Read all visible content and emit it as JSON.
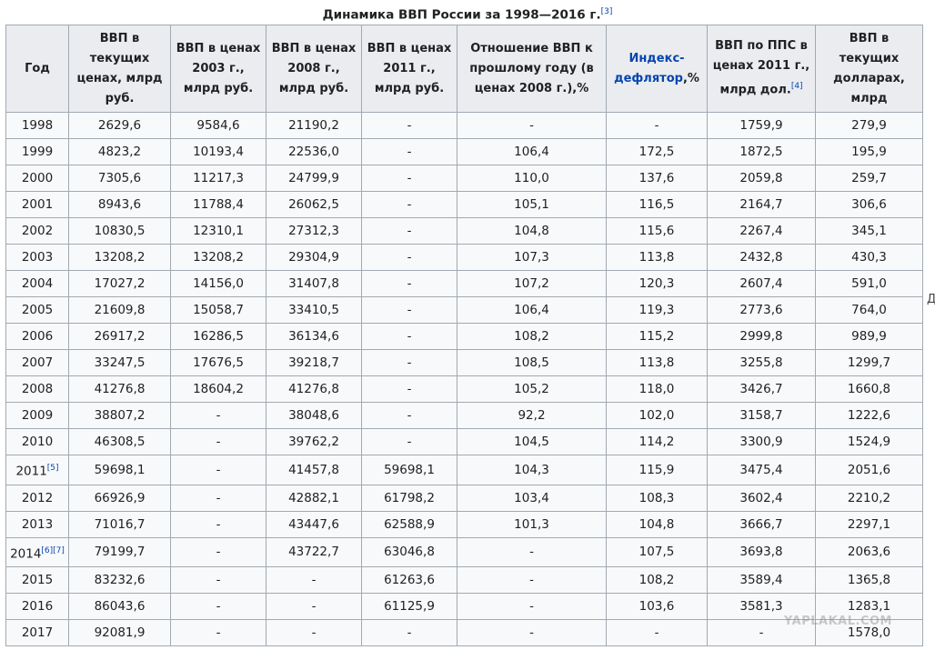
{
  "title": "Динамика ВВП России за 1998—2016 г.",
  "title_ref": "[3]",
  "headers": [
    {
      "text": "Год"
    },
    {
      "text": "ВВП в текущих ценах, млрд руб."
    },
    {
      "text": "ВВП в ценах 2003 г., млрд руб."
    },
    {
      "text": "ВВП в ценах 2008 г., млрд руб."
    },
    {
      "text": "ВВП в ценах 2011 г., млрд руб."
    },
    {
      "text": "Отношение ВВП к прошлому году (в ценах 2008 г.),%"
    },
    {
      "text": "Индекс-дефлятор",
      "suffix": ",%",
      "link": true
    },
    {
      "text": "ВВП по ППС в ценах 2011 г., млрд дол.",
      "ref": "[4]"
    },
    {
      "text": "ВВП в текущих долларах, млрд"
    }
  ],
  "rows": [
    {
      "year": "1998",
      "cells": [
        "2629,6",
        "9584,6",
        "21190,2",
        "-",
        "-",
        "-",
        "1759,9",
        "279,9"
      ]
    },
    {
      "year": "1999",
      "cells": [
        "4823,2",
        "10193,4",
        "22536,0",
        "-",
        "106,4",
        "172,5",
        "1872,5",
        "195,9"
      ]
    },
    {
      "year": "2000",
      "cells": [
        "7305,6",
        "11217,3",
        "24799,9",
        "-",
        "110,0",
        "137,6",
        "2059,8",
        "259,7"
      ]
    },
    {
      "year": "2001",
      "cells": [
        "8943,6",
        "11788,4",
        "26062,5",
        "-",
        "105,1",
        "116,5",
        "2164,7",
        "306,6"
      ]
    },
    {
      "year": "2002",
      "cells": [
        "10830,5",
        "12310,1",
        "27312,3",
        "-",
        "104,8",
        "115,6",
        "2267,4",
        "345,1"
      ]
    },
    {
      "year": "2003",
      "cells": [
        "13208,2",
        "13208,2",
        "29304,9",
        "-",
        "107,3",
        "113,8",
        "2432,8",
        "430,3"
      ]
    },
    {
      "year": "2004",
      "cells": [
        "17027,2",
        "14156,0",
        "31407,8",
        "-",
        "107,2",
        "120,3",
        "2607,4",
        "591,0"
      ]
    },
    {
      "year": "2005",
      "cells": [
        "21609,8",
        "15058,7",
        "33410,5",
        "-",
        "106,4",
        "119,3",
        "2773,6",
        "764,0"
      ]
    },
    {
      "year": "2006",
      "cells": [
        "26917,2",
        "16286,5",
        "36134,6",
        "-",
        "108,2",
        "115,2",
        "2999,8",
        "989,9"
      ]
    },
    {
      "year": "2007",
      "cells": [
        "33247,5",
        "17676,5",
        "39218,7",
        "-",
        "108,5",
        "113,8",
        "3255,8",
        "1299,7"
      ]
    },
    {
      "year": "2008",
      "cells": [
        "41276,8",
        "18604,2",
        "41276,8",
        "-",
        "105,2",
        "118,0",
        "3426,7",
        "1660,8"
      ]
    },
    {
      "year": "2009",
      "cells": [
        "38807,2",
        "-",
        "38048,6",
        "-",
        "92,2",
        "102,0",
        "3158,7",
        "1222,6"
      ]
    },
    {
      "year": "2010",
      "cells": [
        "46308,5",
        "-",
        "39762,2",
        "-",
        "104,5",
        "114,2",
        "3300,9",
        "1524,9"
      ]
    },
    {
      "year": "2011",
      "ref": "[5]",
      "cells": [
        "59698,1",
        "-",
        "41457,8",
        "59698,1",
        "104,3",
        "115,9",
        "3475,4",
        "2051,6"
      ]
    },
    {
      "year": "2012",
      "cells": [
        "66926,9",
        "-",
        "42882,1",
        "61798,2",
        "103,4",
        "108,3",
        "3602,4",
        "2210,2"
      ]
    },
    {
      "year": "2013",
      "cells": [
        "71016,7",
        "-",
        "43447,6",
        "62588,9",
        "101,3",
        "104,8",
        "3666,7",
        "2297,1"
      ]
    },
    {
      "year": "2014",
      "ref": "[6][7]",
      "cells": [
        "79199,7",
        "-",
        "43722,7",
        "63046,8",
        "-",
        "107,5",
        "3693,8",
        "2063,6"
      ]
    },
    {
      "year": "2015",
      "cells": [
        "83232,6",
        "-",
        "-",
        "61263,6",
        "-",
        "108,2",
        "3589,4",
        "1365,8"
      ]
    },
    {
      "year": "2016",
      "cells": [
        "86043,6",
        "-",
        "-",
        "61125,9",
        "-",
        "103,6",
        "3581,3",
        "1283,1"
      ]
    },
    {
      "year": "2017",
      "cells": [
        "92081,9",
        "-",
        "-",
        "-",
        "-",
        "-",
        "-",
        "1578,0"
      ]
    }
  ],
  "edge_text": "Д",
  "watermark": "YAPLAKAL.COM",
  "colors": {
    "link": "#0645ad",
    "header_bg": "#eaecf0",
    "cell_bg": "#f8f9fa",
    "border": "#a2a9b1"
  }
}
